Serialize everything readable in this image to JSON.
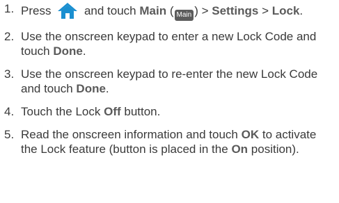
{
  "steps": [
    {
      "num": "1.",
      "parts": {
        "t1": "Press",
        "home_icon": "home-icon",
        "t2": "and touch",
        "main": "Main",
        "paren_open": "(",
        "main_badge": "Main",
        "paren_close": ")",
        "sep1": ">",
        "settings": "Settings",
        "sep2": ">",
        "lock": "Lock",
        "period": "."
      }
    },
    {
      "num": "2.",
      "parts": {
        "t1": "Use the onscreen keypad to enter a new Lock Code and touch",
        "done": "Done",
        "period": "."
      }
    },
    {
      "num": "3.",
      "parts": {
        "t1": "Use the onscreen keypad to re-enter the new Lock Code and touch",
        "done": "Done",
        "period": "."
      }
    },
    {
      "num": "4.",
      "parts": {
        "t1": "Touch the Lock",
        "off": "Off",
        "t2": "button."
      }
    },
    {
      "num": "5.",
      "parts": {
        "t1": "Read the onscreen information and touch",
        "ok": "OK",
        "t2": "to activate the Lock feature (button is placed in the",
        "on": "On",
        "t3": "position)."
      }
    }
  ],
  "colors": {
    "text": "#3a3a3a",
    "emphasis": "#5a5a5a",
    "home_icon_blue": "#1a8fd0",
    "badge_bg": "#5c5c5c"
  }
}
